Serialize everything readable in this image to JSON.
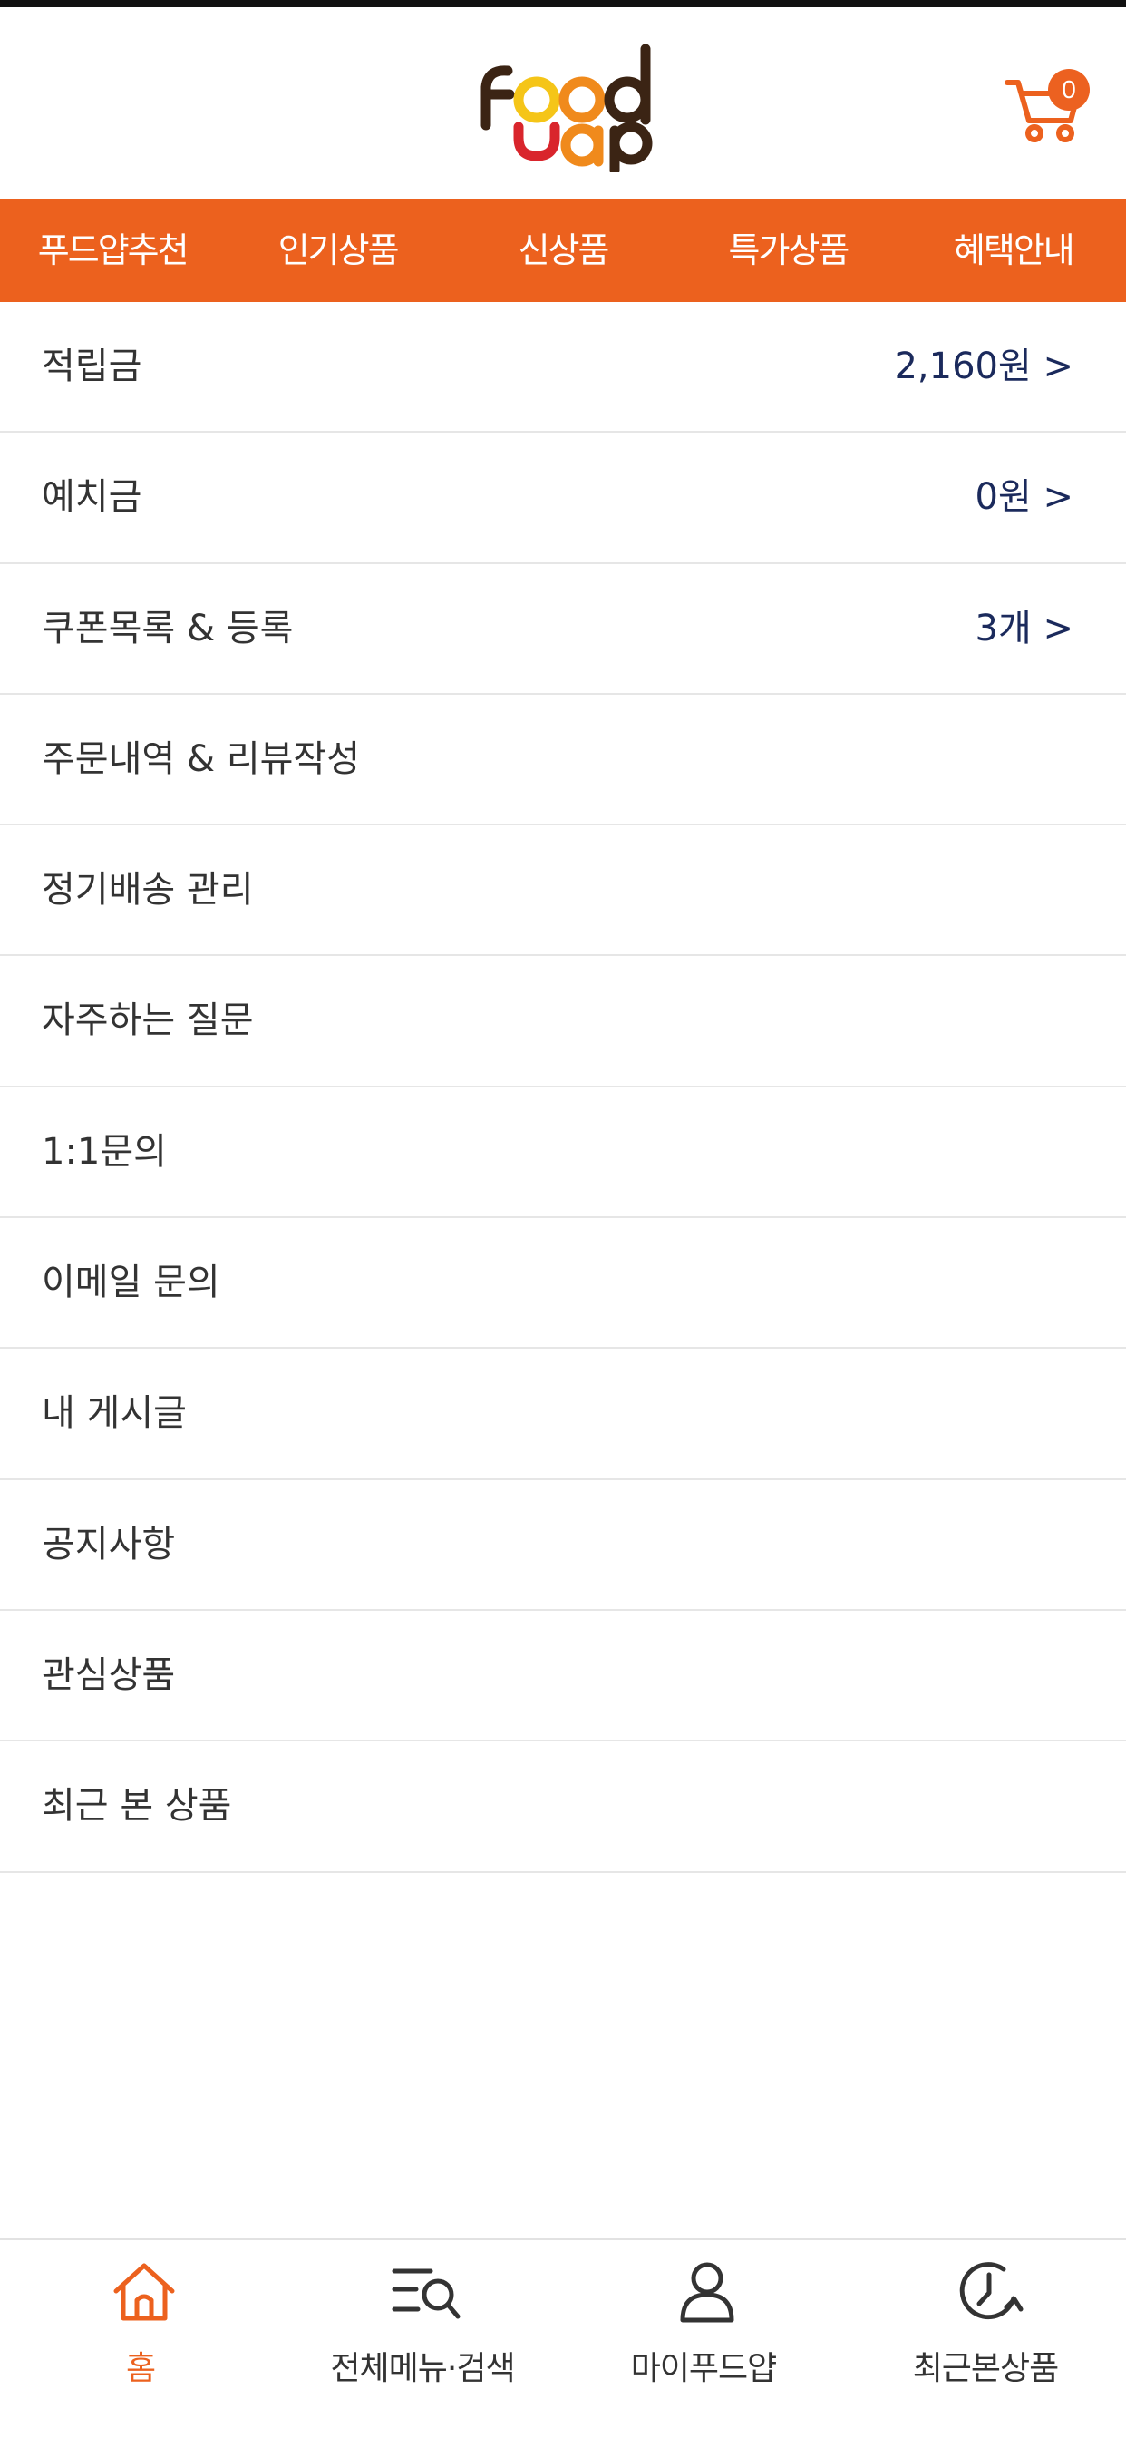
{
  "header": {
    "logo_text_top": "Food",
    "logo_text_bottom": "yap",
    "cart_count": "0"
  },
  "nav": {
    "items": [
      {
        "label": "푸드얍추천"
      },
      {
        "label": "인기상품"
      },
      {
        "label": "신상품"
      },
      {
        "label": "특가상품"
      },
      {
        "label": "혜택안내"
      }
    ]
  },
  "menu": {
    "items": [
      {
        "label": "적립금",
        "value": "2,160원 >"
      },
      {
        "label": "예치금",
        "value": "0원 >"
      },
      {
        "label": "쿠폰목록 & 등록",
        "value": "3개 >"
      },
      {
        "label": "주문내역 & 리뷰작성",
        "value": ""
      },
      {
        "label": "정기배송 관리",
        "value": ""
      },
      {
        "label": "자주하는 질문",
        "value": ""
      },
      {
        "label": "1:1문의",
        "value": ""
      },
      {
        "label": "이메일 문의",
        "value": ""
      },
      {
        "label": "내 게시글",
        "value": ""
      },
      {
        "label": "공지사항",
        "value": ""
      },
      {
        "label": "관심상품",
        "value": ""
      },
      {
        "label": "최근 본 상품",
        "value": ""
      }
    ]
  },
  "tabbar": {
    "items": [
      {
        "label": "홈",
        "icon": "home-icon",
        "active": true
      },
      {
        "label": "전체메뉴·검색",
        "icon": "menu-search-icon",
        "active": false
      },
      {
        "label": "마이푸드얍",
        "icon": "user-icon",
        "active": false
      },
      {
        "label": "최근본상품",
        "icon": "history-icon",
        "active": false
      }
    ]
  },
  "colors": {
    "brand_orange": "#ec611e",
    "value_navy": "#1b2a5c",
    "logo_brown": "#3b2414",
    "logo_yellow": "#f5c518",
    "logo_orange": "#f08a1c",
    "logo_red": "#d9252c"
  }
}
